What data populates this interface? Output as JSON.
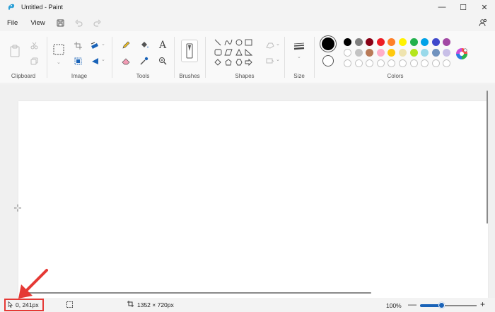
{
  "window": {
    "title": "Untitled - Paint",
    "controls": {
      "minimize": "—",
      "maximize": "☐",
      "close": "✕"
    }
  },
  "menu": {
    "items": [
      "File",
      "View"
    ],
    "icons": [
      "save-icon",
      "undo-icon",
      "redo-icon"
    ],
    "share_icon": "share-people-icon"
  },
  "ribbon": {
    "groups": {
      "clipboard": "Clipboard",
      "image": "Image",
      "tools": "Tools",
      "brushes": "Brushes",
      "shapes": "Shapes",
      "size": "Size",
      "colors": "Colors"
    },
    "tools": {
      "text": "A"
    },
    "colors": {
      "primary": "#000000",
      "secondary": "#ffffff",
      "row1": [
        "#000000",
        "#7f7f7f",
        "#880015",
        "#ed1c24",
        "#ff7f27",
        "#fff200",
        "#22b14c",
        "#00a2e8",
        "#3f48cc",
        "#a349a4"
      ],
      "row2": [
        "#ffffff",
        "#c3c3c3",
        "#b97a57",
        "#ffaec9",
        "#ffc90e",
        "#efe4b0",
        "#b5e61d",
        "#99d9ea",
        "#7092be",
        "#c8bfe7"
      ],
      "row3_empty_count": 10
    }
  },
  "status": {
    "cursor_position": "0, 241px",
    "canvas_size": "1352 × 720px",
    "zoom": "100%",
    "zoom_minus": "—",
    "zoom_plus": "+",
    "zoom_fraction": 0.38
  },
  "annotation": {
    "color": "#e53935"
  }
}
